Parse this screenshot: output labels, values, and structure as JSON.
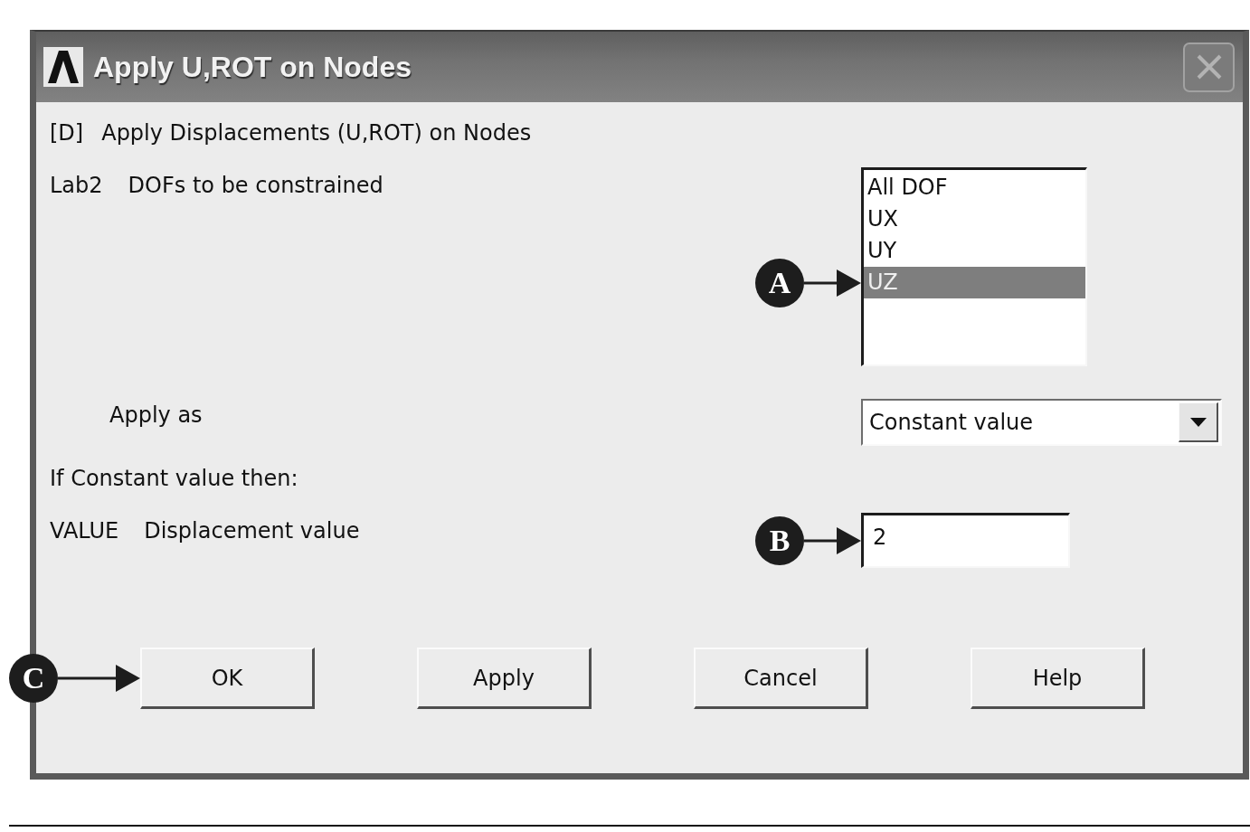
{
  "window": {
    "title": "Apply U,ROT on Nodes"
  },
  "heading": {
    "command": "[D]",
    "text": "Apply Displacements (U,ROT) on Nodes"
  },
  "fields": [
    {
      "kind": "listbox",
      "name": "Lab2",
      "label": "DOFs to be constrained",
      "options": [
        {
          "label": "All DOF",
          "selected": false
        },
        {
          "label": "UX",
          "selected": false
        },
        {
          "label": "UY",
          "selected": false
        },
        {
          "label": "UZ",
          "selected": true,
          "callout": "A"
        }
      ]
    },
    {
      "kind": "dropdown",
      "label": "Apply as",
      "value": "Constant value"
    },
    {
      "kind": "note",
      "label": "If Constant value then:"
    },
    {
      "kind": "text",
      "name": "VALUE",
      "label": "Displacement value",
      "value": "2",
      "callout": "B"
    }
  ],
  "buttons": [
    {
      "label": "OK",
      "callout": "C"
    },
    {
      "label": "Apply"
    },
    {
      "label": "Cancel"
    },
    {
      "label": "Help"
    }
  ]
}
